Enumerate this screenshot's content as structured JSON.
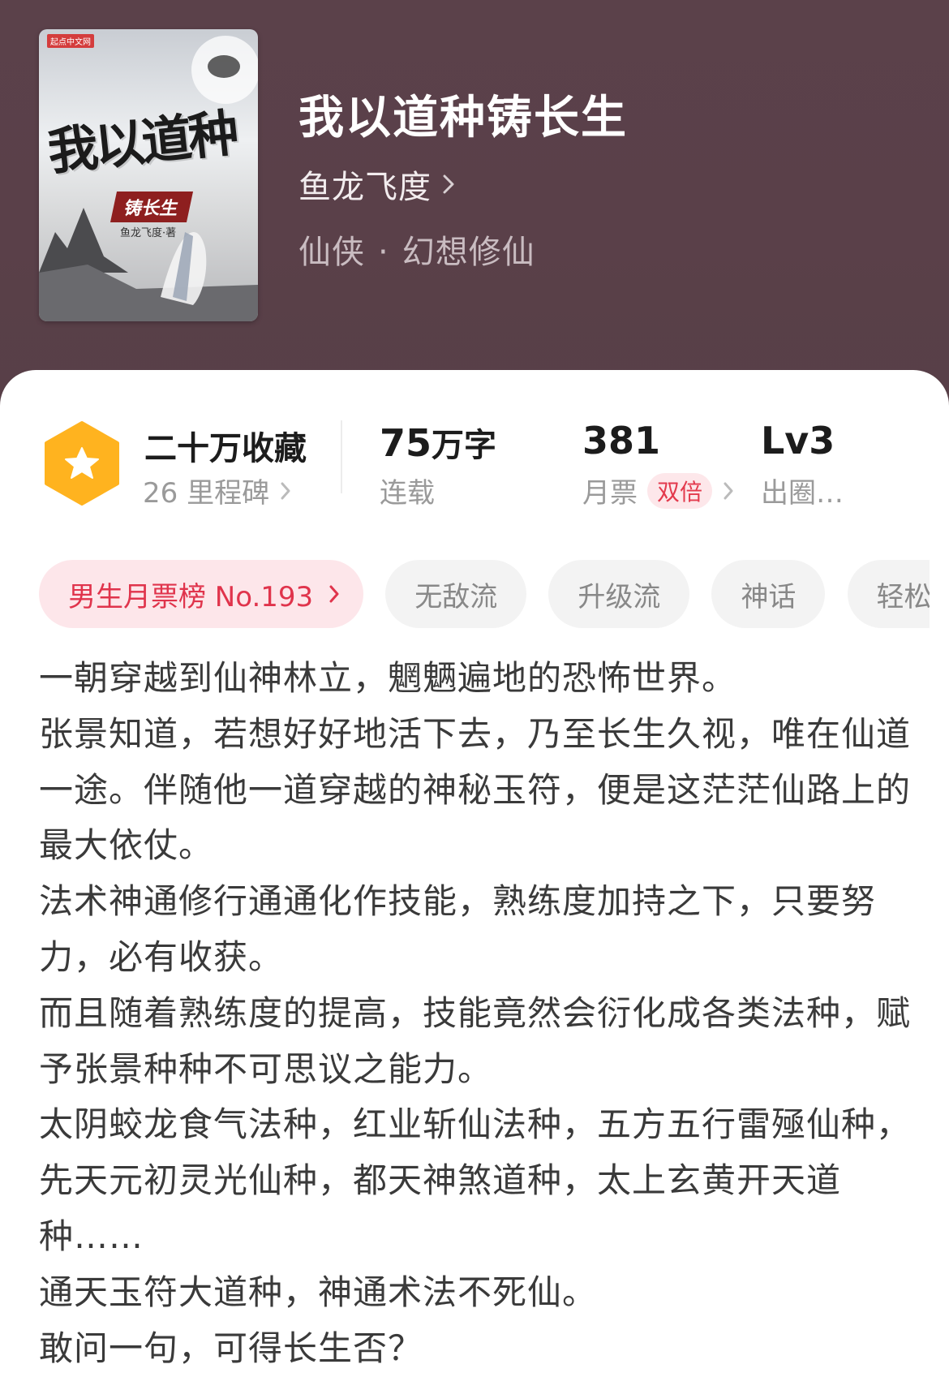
{
  "cover": {
    "publisher_badge": "起点中文网",
    "title_art": "我以道种",
    "subtitle_art": "铸长生",
    "author_art": "鱼龙飞度·著"
  },
  "book": {
    "title": "我以道种铸长生",
    "author": "鱼龙飞度",
    "category": "仙侠",
    "subcategory": "幻想修仙",
    "category_separator": "·"
  },
  "stats": {
    "collections": "二十万收藏",
    "milestones": "26 里程碑",
    "word_count_num": "75",
    "word_count_unit": "万字",
    "status": "连载",
    "monthly_tickets": "381",
    "monthly_tickets_label": "月票",
    "double_label": "双倍",
    "level": "Lv3",
    "level_label": "出圈…"
  },
  "tags": {
    "rank": "男生月票榜 No.193",
    "items": [
      "无敌流",
      "升级流",
      "神话",
      "轻松"
    ]
  },
  "synopsis": [
    "一朝穿越到仙神林立，魍魉遍地的恐怖世界。",
    "张景知道，若想好好地活下去，乃至长生久视，唯在仙道一途。伴随他一道穿越的神秘玉符，便是这茫茫仙路上的最大依仗。",
    "法术神通修行通通化作技能，熟练度加持之下，只要努力，必有收获。",
    "而且随着熟练度的提高，技能竟然会衍化成各类法种，赋予张景种种不可思议之能力。",
    "太阴蛟龙食气法种，红业斩仙法种，五方五行雷殛仙种，先天元初灵光仙种，都天神煞道种，太上玄黄开天道种……",
    "通天玉符大道种，神通术法不死仙。",
    "敢问一句，可得长生否？"
  ],
  "colors": {
    "header_bg": "#5a4049",
    "accent_red": "#e0344c",
    "badge_orange": "#ffb31f"
  },
  "icons": [
    "star-hexagon-icon",
    "chevron-right-icon"
  ]
}
